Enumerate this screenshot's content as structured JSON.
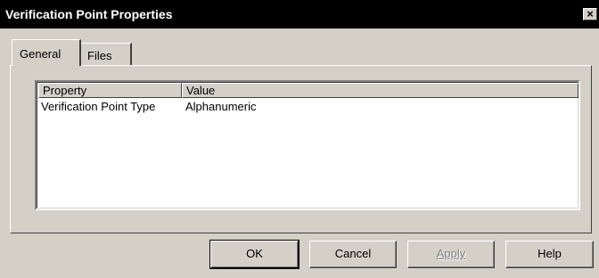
{
  "window": {
    "title": "Verification Point Properties",
    "close_glyph": "×"
  },
  "tabs": [
    {
      "label": "General",
      "active": true
    },
    {
      "label": "Files",
      "active": false
    }
  ],
  "list": {
    "columns": [
      "Property",
      "Value"
    ],
    "rows": [
      {
        "property": "Verification Point Type",
        "value": "Alphanumeric"
      }
    ]
  },
  "buttons": {
    "ok": "OK",
    "cancel": "Cancel",
    "apply": "Apply",
    "help": "Help"
  },
  "colors": {
    "face": "#d4d0c8",
    "titlebar": "#000000",
    "window": "#ffffff"
  }
}
